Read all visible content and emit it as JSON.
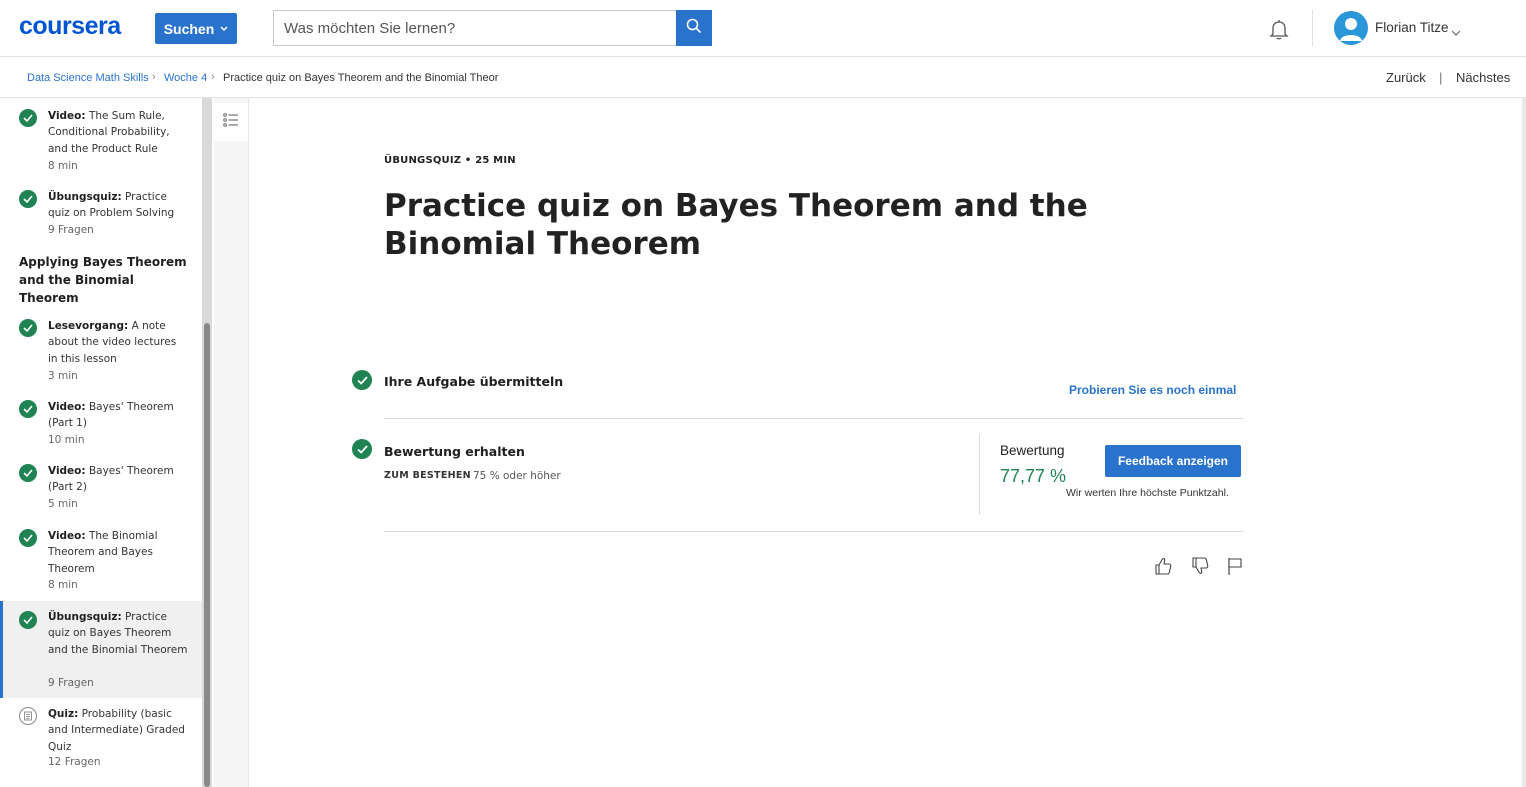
{
  "header": {
    "logo": "coursera",
    "search_button": "Suchen",
    "search_placeholder": "Was möchten Sie lernen?",
    "user_name": "Florian Titze"
  },
  "breadcrumb": {
    "items": [
      "Data Science Math Skills",
      "Woche 4",
      "Practice quiz on Bayes Theorem and the Binomial Theor"
    ],
    "back": "Zurück",
    "separator": "|",
    "next": "Nächstes"
  },
  "sidebar": {
    "items": [
      {
        "type": "Video:",
        "title": "The Sum Rule, Conditional Probability, and the Product Rule",
        "meta": "8 min"
      },
      {
        "type": "Übungsquiz:",
        "title": "Practice quiz on Problem Solving",
        "meta": "9 Fragen"
      },
      {
        "type": "Lesevorgang:",
        "title": "A note about the video lectures in this lesson",
        "meta": "3 min"
      },
      {
        "type": "Video:",
        "title": "Bayes' Theorem (Part 1)",
        "meta": "10 min"
      },
      {
        "type": "Video:",
        "title": "Bayes' Theorem (Part 2)",
        "meta": "5 min"
      },
      {
        "type": "Video:",
        "title": "The Binomial Theorem and Bayes Theorem",
        "meta": "8 min"
      },
      {
        "type": "Übungsquiz:",
        "title": "Practice quiz on Bayes Theorem and the Binomial Theorem",
        "meta": "9 Fragen"
      },
      {
        "type": "Quiz:",
        "title": "Probability (basic and Intermediate) Graded Quiz",
        "meta": "12 Fragen"
      }
    ],
    "section_title": "Applying Bayes Theorem and the Binomial Theorem"
  },
  "main": {
    "kicker": "ÜBUNGSQUIZ • 25 MIN",
    "title": "Practice quiz on Bayes Theorem and the Binomial Theorem",
    "step1_label": "Ihre Aufgabe übermitteln",
    "retry_link": "Probieren Sie es noch einmal",
    "step2_label": "Bewertung erhalten",
    "pass_label": "ZUM BESTEHEN",
    "pass_value": "75 % oder höher",
    "grade_label": "Bewertung",
    "grade_value": "77,77 %",
    "feedback_button": "Feedback anzeigen",
    "grade_note": "Wir werten Ihre höchste Punktzahl."
  },
  "colors": {
    "accent": "#2a73cc",
    "success": "#1f8354",
    "brand": "#0056d2"
  }
}
